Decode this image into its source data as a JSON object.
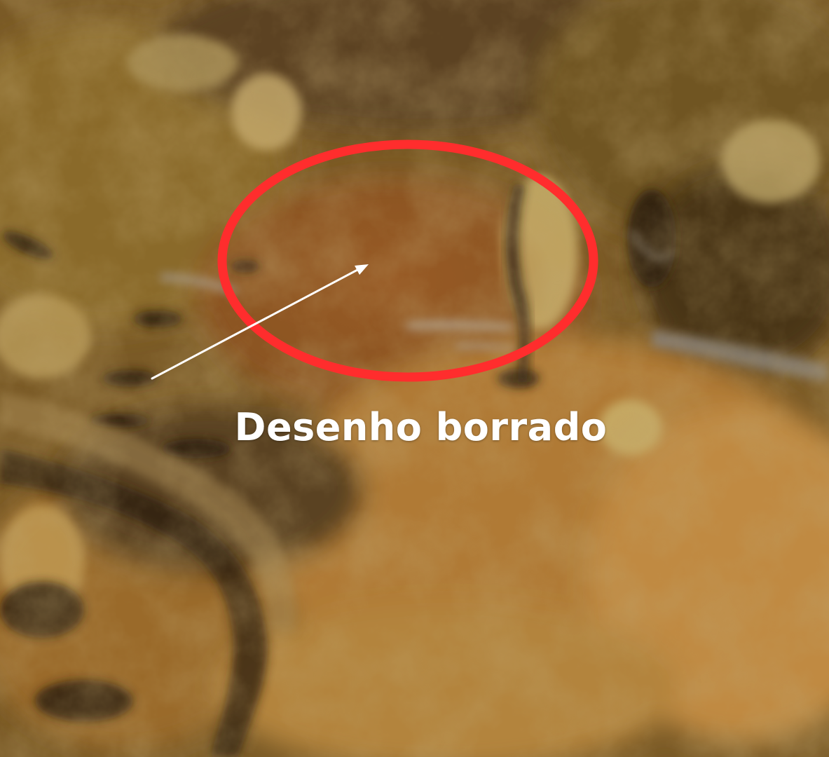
{
  "image": {
    "subject": "rock-surface-texture",
    "palette": {
      "ochre": "#a8772c",
      "dark_brown": "#3a2510",
      "mid_brown": "#7a5220",
      "pale_yellow": "#c9b06a",
      "rust": "#8a4a1c",
      "shadow": "#1e140a",
      "grey_vein": "#8c8884"
    }
  },
  "annotation": {
    "caption": "Desenho borrado",
    "ellipse_color": "#ff2d2d",
    "arrow_color": "#ffffff",
    "caption_color": "#ffffff"
  }
}
